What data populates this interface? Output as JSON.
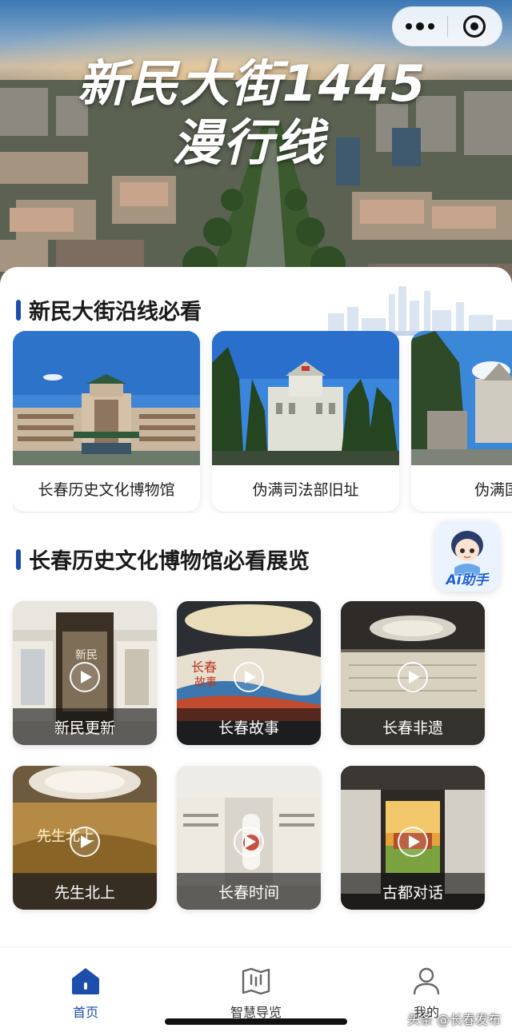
{
  "hero": {
    "title_line1": "新民大街1445",
    "title_line2": "漫行线"
  },
  "capsule": {
    "more_icon": "more-dots-icon",
    "close_icon": "target-icon"
  },
  "section1": {
    "title": "新民大街沿线必看",
    "sites": [
      {
        "label": "长春历史文化博物馆"
      },
      {
        "label": "伪满司法部旧址"
      },
      {
        "label": "伪满国务"
      }
    ]
  },
  "section2": {
    "title": "长春历史文化博物馆必看展览",
    "exhibits": [
      {
        "label": "新民更新"
      },
      {
        "label": "长春故事"
      },
      {
        "label": "长春非遗"
      },
      {
        "label": "先生北上"
      },
      {
        "label": "长春时间"
      },
      {
        "label": "古都对话"
      }
    ]
  },
  "ai_helper": {
    "label": "Ai助手"
  },
  "tabbar": {
    "tabs": [
      {
        "label": "首页",
        "icon": "home-icon",
        "active": true
      },
      {
        "label": "智慧导览",
        "icon": "map-icon",
        "active": false
      },
      {
        "label": "我的",
        "icon": "user-icon",
        "active": false
      }
    ]
  },
  "watermark": "头条 @长春发布",
  "colors": {
    "accent": "#1d4faa",
    "tab_active": "#1d4faa"
  }
}
